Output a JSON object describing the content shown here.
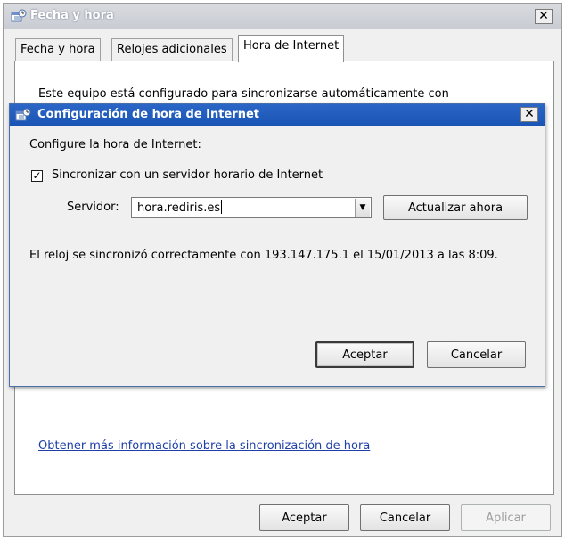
{
  "window": {
    "title": "Fecha y hora",
    "close_label": "✕",
    "tabs": [
      {
        "label": "Fecha y hora"
      },
      {
        "label": "Relojes adicionales"
      },
      {
        "label": "Hora de Internet"
      }
    ],
    "active_tab": "Hora de Internet",
    "panel_text": "Este equipo está configurado para sincronizarse automáticamente con",
    "info_link": "Obtener más información sobre la sincronización de hora",
    "buttons": {
      "ok": "Aceptar",
      "cancel": "Cancelar",
      "apply": "Aplicar"
    }
  },
  "dialog": {
    "title": "Configuración de hora de Internet",
    "close_label": "✕",
    "heading": "Configure la hora de Internet:",
    "sync_checkbox": {
      "label": "Sincronizar con un servidor horario de Internet",
      "checked": true,
      "mark": "✓"
    },
    "server_label": "Servidor:",
    "server_value": "hora.rediris.es",
    "update_button": "Actualizar ahora",
    "status_text": "El reloj se sincronizó correctamente con 193.147.175.1 el 15/01/2013 a las 8:09.",
    "ok_button": "Aceptar",
    "cancel_button": "Cancelar"
  },
  "icons": {
    "app": "calendar-clock-icon",
    "close": "close-icon",
    "dropdown": "chevron-down-icon"
  },
  "colors": {
    "dialog_title_bar": "#2b66c6",
    "link": "#1e3fa8"
  }
}
